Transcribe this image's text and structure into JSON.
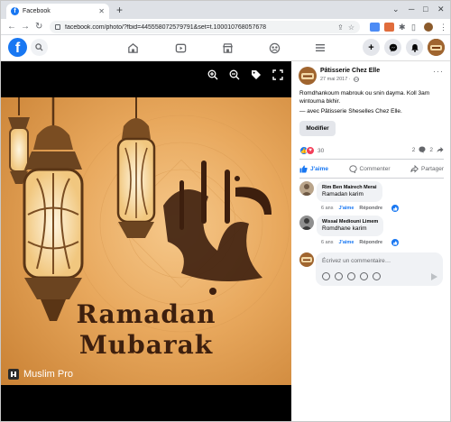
{
  "browser": {
    "tab_title": "Facebook",
    "url": "facebook.com/photo/?fbid=445558072579791&set=t.100010768057678"
  },
  "viewer": {
    "poster_title_line1": "Ramadan",
    "poster_title_line2": "Mubarak",
    "brand": "Muslim Pro"
  },
  "post": {
    "page_name": "Pâtisserie Chez Elle",
    "date": "27 mai 2017 ·",
    "text": "Romdhankoum mabrouk ou snin dayma. Koll 3am wintouma bkhir.",
    "with_prefix": "— avec ",
    "with_page": "Pâtisserie Sheselles Chez Elle",
    "with_suffix": ".",
    "edit_label": "Modifier",
    "reaction_count": "30",
    "comment_count": "2",
    "share_count": "2",
    "actions": {
      "like": "J'aime",
      "comment": "Commenter",
      "share": "Partager"
    }
  },
  "comments": [
    {
      "author": "Rim Ben Mairech Merai",
      "text": "Ramadan karim",
      "time": "6 ans",
      "like": "J'aime",
      "reply": "Répondre"
    },
    {
      "author": "Wissal Mediouni Limem",
      "text": "Romdhane karim",
      "time": "6 ans",
      "like": "J'aime",
      "reply": "Répondre"
    }
  ],
  "composer": {
    "placeholder": "Écrivez un commentaire…"
  },
  "colors": {
    "facebook_blue": "#1877f2",
    "reaction_red": "#f33e58"
  }
}
